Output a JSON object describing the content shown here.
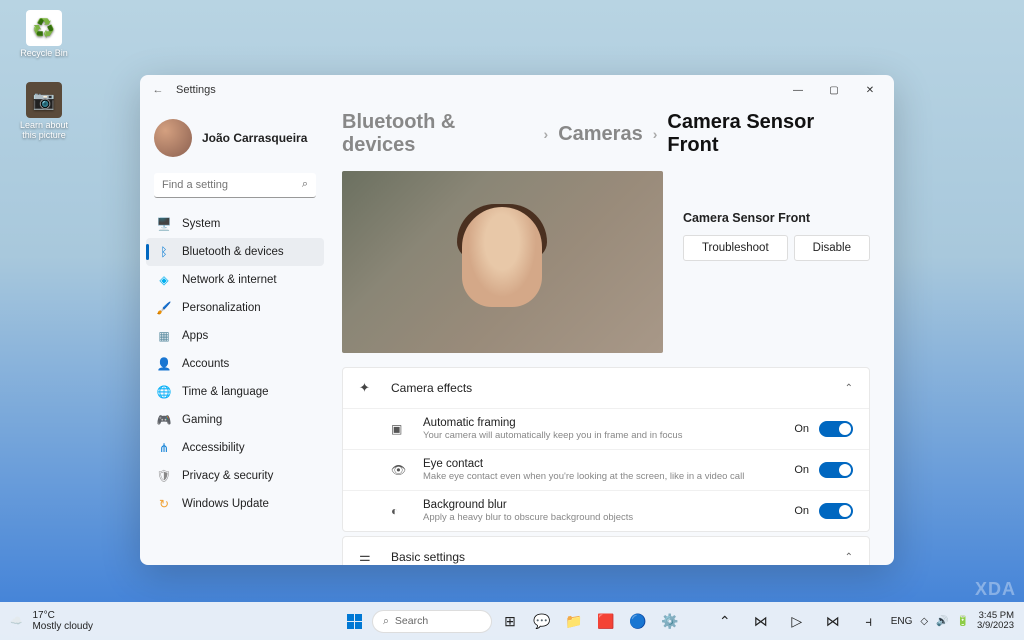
{
  "desktop": {
    "recycle": "Recycle Bin",
    "learn": "Learn about this picture"
  },
  "window": {
    "title": "Settings",
    "user": "João Carrasqueira",
    "search_placeholder": "Find a setting"
  },
  "nav": [
    {
      "icon": "🖥️",
      "label": "System",
      "color": "#0078d4"
    },
    {
      "icon": "ᛒ",
      "label": "Bluetooth & devices",
      "color": "#0078d4",
      "selected": true
    },
    {
      "icon": "◈",
      "label": "Network & internet",
      "color": "#00b0f0"
    },
    {
      "icon": "🖌️",
      "label": "Personalization",
      "color": "#8b5a3c"
    },
    {
      "icon": "▦",
      "label": "Apps",
      "color": "#5a8b9f"
    },
    {
      "icon": "👤",
      "label": "Accounts",
      "color": "#4a90c2"
    },
    {
      "icon": "🌐",
      "label": "Time & language",
      "color": "#3b9f9f"
    },
    {
      "icon": "🎮",
      "label": "Gaming",
      "color": "#888"
    },
    {
      "icon": "⋔",
      "label": "Accessibility",
      "color": "#0078d4"
    },
    {
      "icon": "🛡",
      "label": "Privacy & security",
      "color": "#888"
    },
    {
      "icon": "↻",
      "label": "Windows Update",
      "color": "#f0a030"
    }
  ],
  "breadcrumb": {
    "a": "Bluetooth & devices",
    "b": "Cameras",
    "c": "Camera Sensor Front"
  },
  "preview": {
    "label": "Camera Sensor Front",
    "troubleshoot": "Troubleshoot",
    "disable": "Disable"
  },
  "effects": {
    "header": "Camera effects",
    "items": [
      {
        "title": "Automatic framing",
        "desc": "Your camera will automatically keep you in frame and in focus",
        "state": "On"
      },
      {
        "title": "Eye contact",
        "desc": "Make eye contact even when you're looking at the screen, like in a video call",
        "state": "On"
      },
      {
        "title": "Background blur",
        "desc": "Apply a heavy blur to obscure background objects",
        "state": "On"
      }
    ]
  },
  "basic": {
    "header": "Basic settings"
  },
  "taskbar": {
    "temp": "17°C",
    "cond": "Mostly cloudy",
    "search": "Search",
    "lang": "ENG",
    "time": "3:45 PM",
    "date": "3/9/2023"
  },
  "watermark": "XDA"
}
